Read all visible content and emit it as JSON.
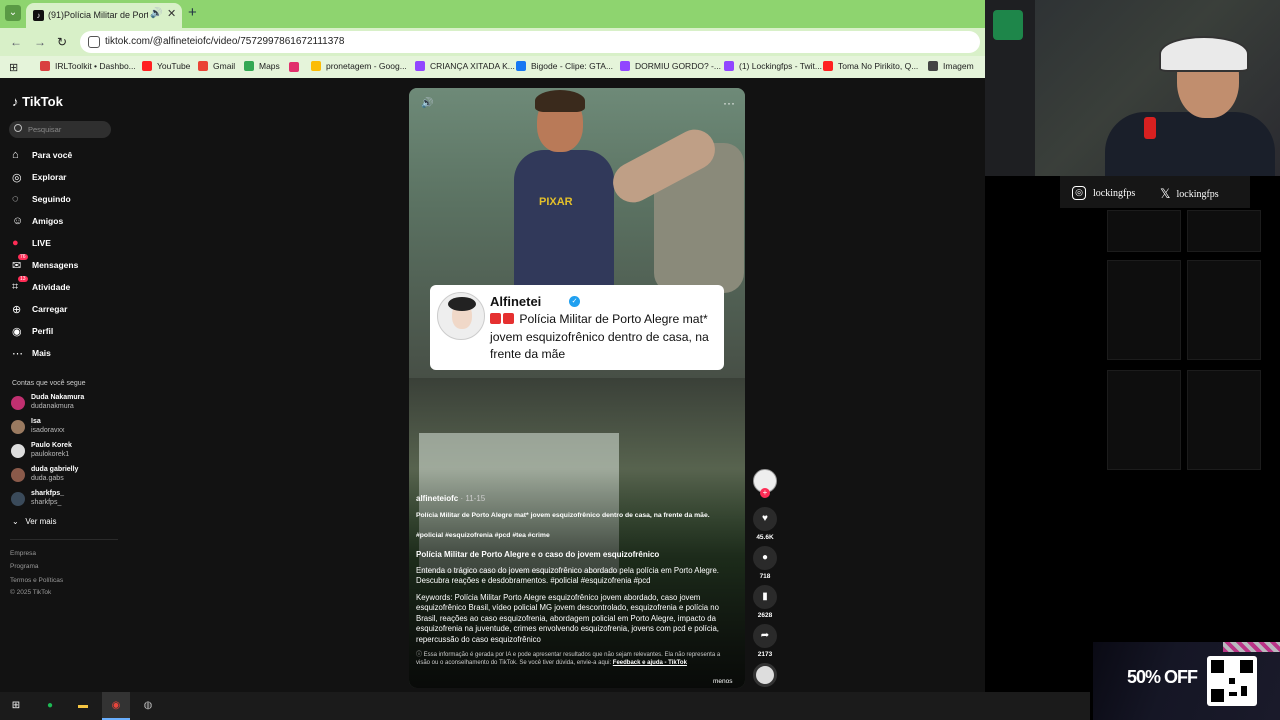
{
  "browser": {
    "tab_title": "(91)Polícia Militar de Porto",
    "tab_audio_icon": "speaker-icon",
    "url": "tiktok.com/@alfineteiofc/video/7572997861672111378",
    "bookmarks": [
      {
        "label": "IRLToolkit • Dashbo...",
        "color": "#d94040"
      },
      {
        "label": "YouTube",
        "color": "#ff2020"
      },
      {
        "label": "Gmail",
        "color": "#ea4335"
      },
      {
        "label": "Maps",
        "color": "#34a853"
      },
      {
        "label": "pronetagem - Goog...",
        "color": "#fbbc05"
      },
      {
        "label": "CRIANÇA XITADA K...",
        "color": "#9146ff"
      },
      {
        "label": "Bigode - Clipe: GTA...",
        "color": "#1877f2"
      },
      {
        "label": "DORMIU GORDO? -...",
        "color": "#9146ff"
      },
      {
        "label": "(1) Lockingfps - Twit...",
        "color": "#9146ff"
      },
      {
        "label": "Toma No Pirikito, Q...",
        "color": "#ff2020"
      },
      {
        "label": "Imagem",
        "color": "#444444"
      }
    ]
  },
  "tiktok": {
    "logo": "TikTok",
    "search_placeholder": "Pesquisar",
    "nav": [
      {
        "label": "Para você",
        "icon": "home-icon"
      },
      {
        "label": "Explorar",
        "icon": "compass-icon"
      },
      {
        "label": "Seguindo",
        "icon": "following-icon"
      },
      {
        "label": "Amigos",
        "icon": "friends-icon"
      },
      {
        "label": "LIVE",
        "icon": "live-icon"
      },
      {
        "label": "Mensagens",
        "icon": "messages-icon",
        "badge": "76"
      },
      {
        "label": "Atividade",
        "icon": "activity-icon",
        "badge": "13"
      },
      {
        "label": "Carregar",
        "icon": "upload-icon"
      },
      {
        "label": "Perfil",
        "icon": "profile-icon"
      },
      {
        "label": "Mais",
        "icon": "more-icon"
      }
    ],
    "following_title": "Contas que você segue",
    "following": [
      {
        "name": "Duda Nakamura",
        "handle": "dudanakmura",
        "color": "#c03070"
      },
      {
        "name": "Isa",
        "handle": "isadoravxx",
        "color": "#9a7a60"
      },
      {
        "name": "Paulo Korek",
        "handle": "paulokorek1",
        "color": "#dddddd"
      },
      {
        "name": "duda gabrielly",
        "handle": "duda.gabs",
        "color": "#8a5a4a"
      },
      {
        "name": "sharkfps_",
        "handle": "sharkfps_",
        "color": "#3a4a5a"
      }
    ],
    "see_more": "Ver mais",
    "footer": [
      "Empresa",
      "Programa",
      "Termos e Políticas",
      "© 2025 TikTok"
    ]
  },
  "video": {
    "shirt_text": "PIXAR",
    "card": {
      "name": "Alfinetei",
      "text_line1": "Polícia Militar de Porto Alegre mat*",
      "text_rest": "jovem esquizofrênico dentro de casa, na frente da mãe"
    },
    "author": "alfineteiofc",
    "date": "· 11-15",
    "description": "Polícia Militar de Porto Alegre mat* jovem esquizofrênico dentro de casa, na frente da mãe.",
    "tags": "#policial #esquizofrenia #pcd #tea #crime",
    "ai_heading": "Polícia Militar de Porto Alegre e o caso do jovem esquizofrênico",
    "ai_paragraph": "Entenda o trágico caso do jovem esquizofrênico abordado pela polícia em Porto Alegre. Descubra reações e desdobramentos. #policial #esquizofrenia #pcd",
    "keywords": "Keywords: Polícia Militar Porto Alegre esquizofrênico jovem abordado, caso jovem esquizofrênico Brasil, vídeo policial MG jovem descontrolado, esquizofrenia e polícia no Brasil, reações ao caso esquizofrenia, abordagem policial em Porto Alegre, impacto da esquizofrenia na juventude, crimes envolvendo esquizofrenia, jovens com pcd e polícia, repercussão do caso esquizofrênico",
    "ai_notice": "Essa informação é gerada por IA e pode apresentar resultados que não sejam relevantes. Ela não representa a visão ou o aconselhamento do TikTok. Se você tiver dúvida, envie-a aqui:",
    "ai_link": "Feedback e ajuda - TikTok",
    "less": "menos",
    "progress": 0.42
  },
  "rail": {
    "likes": "45.6K",
    "comments": "718",
    "saves": "2628",
    "shares": "2173"
  },
  "stream": {
    "instagram": "lockingfps",
    "x": "lockingfps",
    "promo": "50% OFF"
  },
  "taskbar": [
    {
      "icon": "windows-start-icon",
      "color": "#ffffff"
    },
    {
      "icon": "spotify-icon",
      "color": "#1db954"
    },
    {
      "icon": "file-explorer-icon",
      "color": "#f5c542"
    },
    {
      "icon": "chrome-icon",
      "color": "#e8453c"
    },
    {
      "icon": "steering-wheel-icon",
      "color": "#bbbbbb"
    }
  ]
}
